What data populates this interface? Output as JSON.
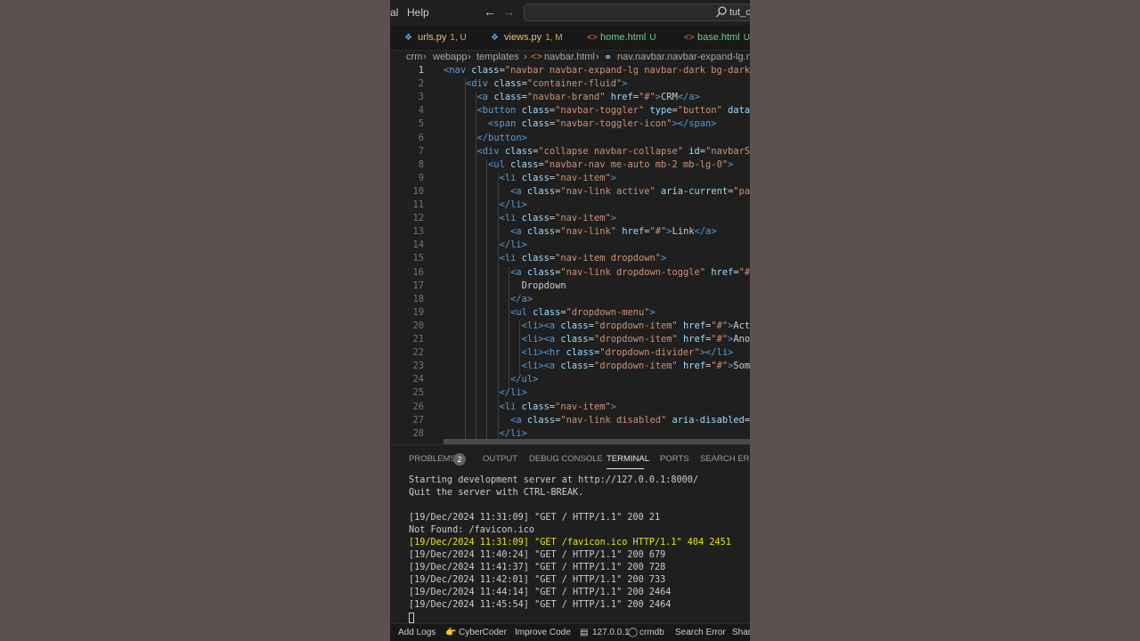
{
  "menu": {
    "items": [
      "al",
      "Help"
    ]
  },
  "search": {
    "text": "tut_cr"
  },
  "tabs": [
    {
      "name": "urls.py",
      "badge": "1, U",
      "icon": "python-file-icon",
      "color": "#e5c07b",
      "badge_color": "#d4a94e",
      "icon_color": "#5aa5d6"
    },
    {
      "name": "views.py",
      "badge": "1, M",
      "icon": "python-file-icon",
      "color": "#e5c07b",
      "badge_color": "#d4a94e",
      "icon_color": "#5aa5d6"
    },
    {
      "name": "home.html",
      "badge": "U",
      "icon": "html-file-icon",
      "color": "#73c991",
      "badge_color": "#73c991",
      "icon_color": "#e37933"
    },
    {
      "name": "base.html",
      "badge": "U",
      "icon": "html-file-icon",
      "color": "#73c991",
      "badge_color": "#73c991",
      "icon_color": "#e37933"
    }
  ],
  "breadcrumb": [
    "crm",
    "webapp",
    "templates",
    "navbar.html",
    "nav.navbar.navbar-expand-lg.navb"
  ],
  "code": {
    "active_line": 1,
    "lines": [
      [
        [
          0,
          ""
        ],
        [
          1,
          "<nav"
        ],
        [
          2,
          " class"
        ],
        [
          3,
          "="
        ],
        [
          4,
          "\"navbar navbar-expand-lg navbar-dark bg-dark\""
        ]
      ],
      [
        [
          0,
          "    "
        ],
        [
          1,
          "<div"
        ],
        [
          2,
          " class"
        ],
        [
          3,
          "="
        ],
        [
          4,
          "\"container-fluid\""
        ],
        [
          1,
          ">"
        ]
      ],
      [
        [
          0,
          "      "
        ],
        [
          1,
          "<a"
        ],
        [
          2,
          " class"
        ],
        [
          3,
          "="
        ],
        [
          4,
          "\"navbar-brand\""
        ],
        [
          2,
          " href"
        ],
        [
          3,
          "="
        ],
        [
          4,
          "\"#\""
        ],
        [
          1,
          ">"
        ],
        [
          3,
          "CRM"
        ],
        [
          1,
          "</a>"
        ]
      ],
      [
        [
          0,
          "      "
        ],
        [
          1,
          "<button"
        ],
        [
          2,
          " class"
        ],
        [
          3,
          "="
        ],
        [
          4,
          "\"navbar-toggler\""
        ],
        [
          2,
          " type"
        ],
        [
          3,
          "="
        ],
        [
          4,
          "\"button\""
        ],
        [
          2,
          " data-"
        ]
      ],
      [
        [
          0,
          "        "
        ],
        [
          1,
          "<span"
        ],
        [
          2,
          " class"
        ],
        [
          3,
          "="
        ],
        [
          4,
          "\"navbar-toggler-icon\""
        ],
        [
          1,
          "></span>"
        ]
      ],
      [
        [
          0,
          "      "
        ],
        [
          1,
          "</button>"
        ]
      ],
      [
        [
          0,
          "      "
        ],
        [
          1,
          "<div"
        ],
        [
          2,
          " class"
        ],
        [
          3,
          "="
        ],
        [
          4,
          "\"collapse navbar-collapse\""
        ],
        [
          2,
          " id"
        ],
        [
          3,
          "="
        ],
        [
          4,
          "\"navbarSu"
        ]
      ],
      [
        [
          0,
          "        "
        ],
        [
          1,
          "<ul"
        ],
        [
          2,
          " class"
        ],
        [
          3,
          "="
        ],
        [
          4,
          "\"navbar-nav me-auto mb-2 mb-lg-0\""
        ],
        [
          1,
          ">"
        ]
      ],
      [
        [
          0,
          "          "
        ],
        [
          1,
          "<li"
        ],
        [
          2,
          " class"
        ],
        [
          3,
          "="
        ],
        [
          4,
          "\"nav-item\""
        ],
        [
          1,
          ">"
        ]
      ],
      [
        [
          0,
          "            "
        ],
        [
          1,
          "<a"
        ],
        [
          2,
          " class"
        ],
        [
          3,
          "="
        ],
        [
          4,
          "\"nav-link active\""
        ],
        [
          2,
          " aria-current"
        ],
        [
          3,
          "="
        ],
        [
          4,
          "\"pag"
        ]
      ],
      [
        [
          0,
          "          "
        ],
        [
          1,
          "</li>"
        ]
      ],
      [
        [
          0,
          "          "
        ],
        [
          1,
          "<li"
        ],
        [
          2,
          " class"
        ],
        [
          3,
          "="
        ],
        [
          4,
          "\"nav-item\""
        ],
        [
          1,
          ">"
        ]
      ],
      [
        [
          0,
          "            "
        ],
        [
          1,
          "<a"
        ],
        [
          2,
          " class"
        ],
        [
          3,
          "="
        ],
        [
          4,
          "\"nav-link\""
        ],
        [
          2,
          " href"
        ],
        [
          3,
          "="
        ],
        [
          4,
          "\"#\""
        ],
        [
          1,
          ">"
        ],
        [
          3,
          "Link"
        ],
        [
          1,
          "</a>"
        ]
      ],
      [
        [
          0,
          "          "
        ],
        [
          1,
          "</li>"
        ]
      ],
      [
        [
          0,
          "          "
        ],
        [
          1,
          "<li"
        ],
        [
          2,
          " class"
        ],
        [
          3,
          "="
        ],
        [
          4,
          "\"nav-item dropdown\""
        ],
        [
          1,
          ">"
        ]
      ],
      [
        [
          0,
          "            "
        ],
        [
          1,
          "<a"
        ],
        [
          2,
          " class"
        ],
        [
          3,
          "="
        ],
        [
          4,
          "\"nav-link dropdown-toggle\""
        ],
        [
          2,
          " href"
        ],
        [
          3,
          "="
        ],
        [
          4,
          "\"#\""
        ]
      ],
      [
        [
          0,
          "              "
        ],
        [
          3,
          "Dropdown"
        ]
      ],
      [
        [
          0,
          "            "
        ],
        [
          1,
          "</a>"
        ]
      ],
      [
        [
          0,
          "            "
        ],
        [
          1,
          "<ul"
        ],
        [
          2,
          " class"
        ],
        [
          3,
          "="
        ],
        [
          4,
          "\"dropdown-menu\""
        ],
        [
          1,
          ">"
        ]
      ],
      [
        [
          0,
          "              "
        ],
        [
          1,
          "<li><a"
        ],
        [
          2,
          " class"
        ],
        [
          3,
          "="
        ],
        [
          4,
          "\"dropdown-item\""
        ],
        [
          2,
          " href"
        ],
        [
          3,
          "="
        ],
        [
          4,
          "\"#\""
        ],
        [
          1,
          ">"
        ],
        [
          3,
          "Acti"
        ]
      ],
      [
        [
          0,
          "              "
        ],
        [
          1,
          "<li><a"
        ],
        [
          2,
          " class"
        ],
        [
          3,
          "="
        ],
        [
          4,
          "\"dropdown-item\""
        ],
        [
          2,
          " href"
        ],
        [
          3,
          "="
        ],
        [
          4,
          "\"#\""
        ],
        [
          1,
          ">"
        ],
        [
          3,
          "Anot"
        ]
      ],
      [
        [
          0,
          "              "
        ],
        [
          1,
          "<li><hr"
        ],
        [
          2,
          " class"
        ],
        [
          3,
          "="
        ],
        [
          4,
          "\"dropdown-divider\""
        ],
        [
          1,
          "></li>"
        ]
      ],
      [
        [
          0,
          "              "
        ],
        [
          1,
          "<li><a"
        ],
        [
          2,
          " class"
        ],
        [
          3,
          "="
        ],
        [
          4,
          "\"dropdown-item\""
        ],
        [
          2,
          " href"
        ],
        [
          3,
          "="
        ],
        [
          4,
          "\"#\""
        ],
        [
          1,
          ">"
        ],
        [
          3,
          "Some"
        ]
      ],
      [
        [
          0,
          "            "
        ],
        [
          1,
          "</ul>"
        ]
      ],
      [
        [
          0,
          "          "
        ],
        [
          1,
          "</li>"
        ]
      ],
      [
        [
          0,
          "          "
        ],
        [
          1,
          "<li"
        ],
        [
          2,
          " class"
        ],
        [
          3,
          "="
        ],
        [
          4,
          "\"nav-item\""
        ],
        [
          1,
          ">"
        ]
      ],
      [
        [
          0,
          "            "
        ],
        [
          1,
          "<a"
        ],
        [
          2,
          " class"
        ],
        [
          3,
          "="
        ],
        [
          4,
          "\"nav-link disabled\""
        ],
        [
          2,
          " aria-disabled"
        ],
        [
          3,
          "="
        ],
        [
          4,
          "\""
        ]
      ],
      [
        [
          0,
          "          "
        ],
        [
          1,
          "</li>"
        ]
      ]
    ],
    "colors": {
      "1": "#569cd6",
      "2": "#9cdcfe",
      "3": "#cccccc",
      "4": "#ce9178"
    }
  },
  "panel": {
    "tabs": [
      "PROBLEMS",
      "OUTPUT",
      "DEBUG CONSOLE",
      "TERMINAL",
      "PORTS",
      "SEARCH ERRO"
    ],
    "problems_count": "2",
    "active": "TERMINAL"
  },
  "terminal": {
    "lines": [
      {
        "text": "Starting development server at http://127.0.0.1:8000/",
        "color": "#cccccc"
      },
      {
        "text": "Quit the server with CTRL-BREAK.",
        "color": "#cccccc"
      },
      {
        "text": "",
        "color": "#cccccc"
      },
      {
        "text": "[19/Dec/2024 11:31:09] \"GET / HTTP/1.1\" 200 21",
        "color": "#cccccc"
      },
      {
        "text": "Not Found: /favicon.ico",
        "color": "#cccccc"
      },
      {
        "text": "[19/Dec/2024 11:31:09] \"GET /favicon.ico HTTP/1.1\" 404 2451",
        "color": "#e5e510"
      },
      {
        "text": "[19/Dec/2024 11:40:24] \"GET / HTTP/1.1\" 200 679",
        "color": "#cccccc"
      },
      {
        "text": "[19/Dec/2024 11:41:37] \"GET / HTTP/1.1\" 200 728",
        "color": "#cccccc"
      },
      {
        "text": "[19/Dec/2024 11:42:01] \"GET / HTTP/1.1\" 200 733",
        "color": "#cccccc"
      },
      {
        "text": "[19/Dec/2024 11:44:14] \"GET / HTTP/1.1\" 200 2464",
        "color": "#cccccc"
      },
      {
        "text": "[19/Dec/2024 11:45:54] \"GET / HTTP/1.1\" 200 2464",
        "color": "#cccccc"
      }
    ]
  },
  "status": {
    "add_logs": "Add Logs",
    "cybercoder": "CyberCoder",
    "cybercoder_icon": "👉",
    "improve_code": "Improve Code",
    "server": "127.0.0.1",
    "db": "crmdb",
    "search_error": "Search Error",
    "share": "Share"
  }
}
